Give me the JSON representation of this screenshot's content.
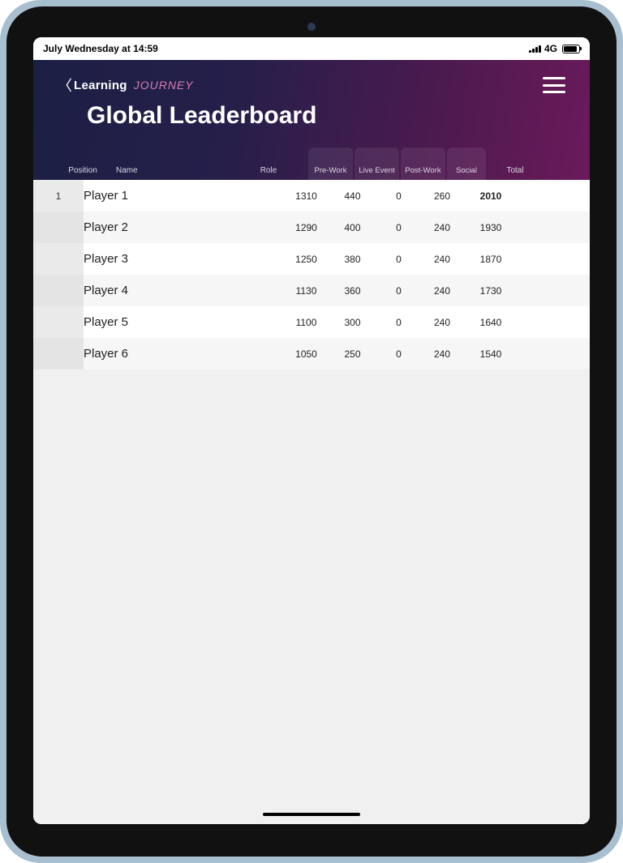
{
  "status": {
    "datetime": "July Wednesday at 14:59",
    "network": "4G"
  },
  "brand": {
    "learning": "Learning",
    "journey": "JOURNEY"
  },
  "page": {
    "title": "Global Leaderboard"
  },
  "columns": {
    "position": "Position",
    "name": "Name",
    "role": "Role",
    "prework": "Pre-Work",
    "liveevent": "Live Event",
    "postwork": "Post-Work",
    "social": "Social",
    "total": "Total"
  },
  "rows": [
    {
      "position": "1",
      "name": "Player 1",
      "role": "",
      "prework": "1310",
      "liveevent": "440",
      "postwork": "0",
      "social": "260",
      "total": "2010"
    },
    {
      "position": "",
      "name": "Player 2",
      "role": "",
      "prework": "1290",
      "liveevent": "400",
      "postwork": "0",
      "social": "240",
      "total": "1930"
    },
    {
      "position": "",
      "name": "Player 3",
      "role": "",
      "prework": "1250",
      "liveevent": "380",
      "postwork": "0",
      "social": "240",
      "total": "1870"
    },
    {
      "position": "",
      "name": "Player 4",
      "role": "",
      "prework": "1130",
      "liveevent": "360",
      "postwork": "0",
      "social": "240",
      "total": "1730"
    },
    {
      "position": "",
      "name": "Player 5",
      "role": "",
      "prework": "1100",
      "liveevent": "300",
      "postwork": "0",
      "social": "240",
      "total": "1640"
    },
    {
      "position": "",
      "name": "Player 6",
      "role": "",
      "prework": "1050",
      "liveevent": "250",
      "postwork": "0",
      "social": "240",
      "total": "1540"
    }
  ]
}
